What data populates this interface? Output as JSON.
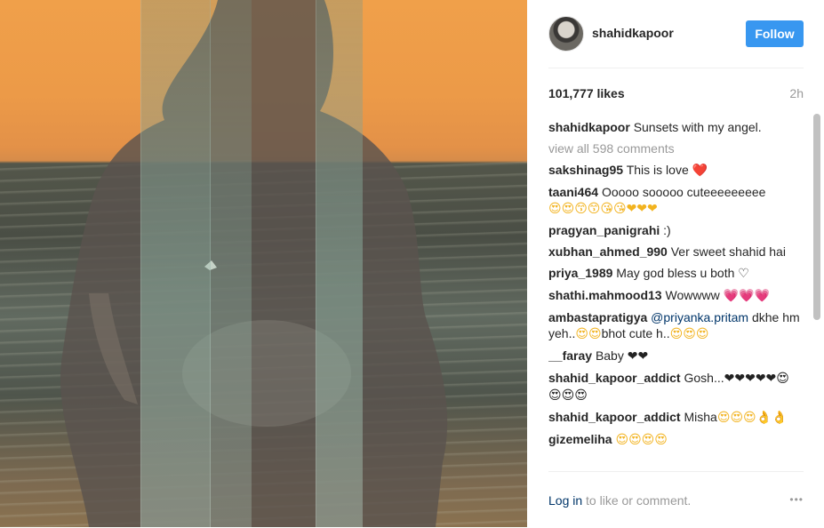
{
  "post": {
    "username": "shahidkapoor",
    "follow_label": "Follow",
    "likes": "101,777 likes",
    "time_ago": "2h",
    "caption_user": "shahidkapoor",
    "caption_text": "Sunsets with my angel.",
    "view_all": "view all 598 comments"
  },
  "comments": [
    {
      "user": "sakshinag95",
      "text": "This is love",
      "emoji": "❤️"
    },
    {
      "user": "taani464",
      "text": "Ooooo sooooo cuteeeeeeeee",
      "emoji": "😍😍😙😙😘😘❤❤❤"
    },
    {
      "user": "pragyan_panigrahi",
      "text": ":)",
      "emoji": ""
    },
    {
      "user": "xubhan_ahmed_990",
      "text": "Ver sweet shahid hai",
      "emoji": ""
    },
    {
      "user": "priya_1989",
      "text": "May god bless u both",
      "emoji": "♡"
    },
    {
      "user": "shathi.mahmood13",
      "text": "Wowwww",
      "emoji": "💗💗💗"
    },
    {
      "user": "ambastapratigya",
      "mention": "@priyanka.pritam",
      "text": "dkhe hm yeh..",
      "emoji": "😍😍",
      "text2": "bhot cute h..",
      "emoji2": "😍😍😍"
    },
    {
      "user": "__faray",
      "text": "Baby",
      "emoji": "❤❤"
    },
    {
      "user": "shahid_kapoor_addict",
      "text": "Gosh...",
      "emoji": "❤❤❤❤❤😍😍😍😍"
    },
    {
      "user": "shahid_kapoor_addict",
      "text": "Misha",
      "emoji": "😍😍😍👌👌"
    },
    {
      "user": "gizemeliha",
      "text": "",
      "emoji": "😍😍😍😍"
    }
  ],
  "footer": {
    "login_link": "Log in",
    "login_text": " to like or comment.",
    "more_icon": "•••"
  }
}
